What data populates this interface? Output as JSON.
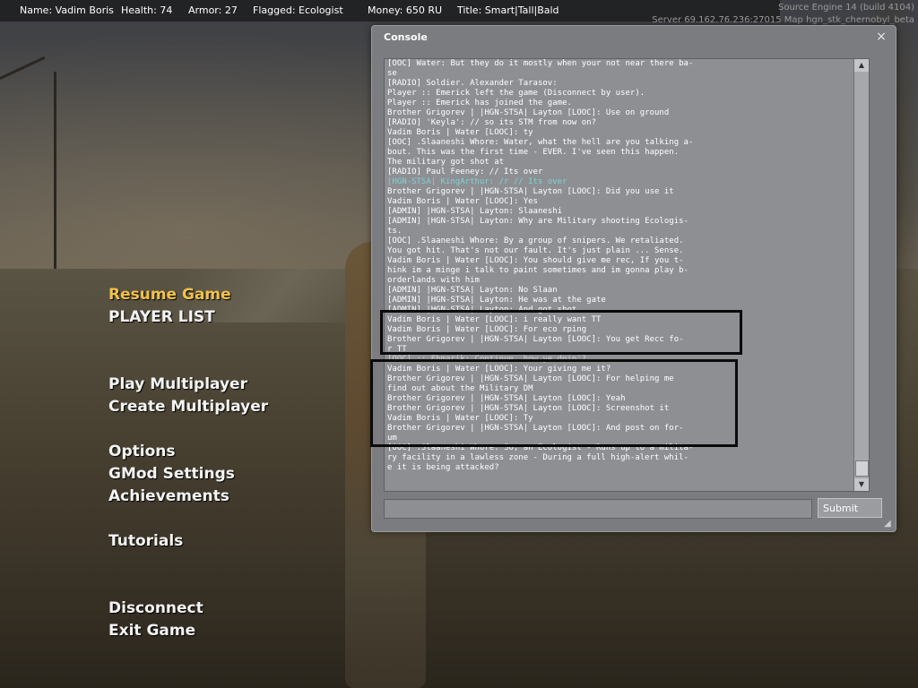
{
  "hud": {
    "name": "Name: Vadim Boris",
    "health": "Health: 74",
    "armor": "Armor: 27",
    "flagged": "Flagged: Ecologist",
    "money": "Money: 650 RU",
    "title": "Title: Smart|Tall|Bald"
  },
  "server": {
    "engine": "Source Engine 14 (build 4104)",
    "info": "Server 69.162.76.236:27015 Map hgn_stk_chernobyl_beta"
  },
  "menu": {
    "resume": "Resume Game",
    "player_list": "PLAYER LIST",
    "play_multi": "Play Multiplayer",
    "create_multi": "Create Multiplayer",
    "options": "Options",
    "gmod_settings": "GMod Settings",
    "achievements": "Achievements",
    "tutorials": "Tutorials",
    "disconnect": "Disconnect",
    "exit": "Exit Game"
  },
  "console": {
    "title": "Console",
    "close": "×",
    "submit": "Submit",
    "input_value": "",
    "lines": [
      "[OOC] Water: But they do it mostly when your not near there ba-",
      "se",
      "[RADIO] Soldier. Alexander Tarasov:",
      "Player :: Emerick left the game (Disconnect by user).",
      "Player :: Emerick has joined the game.",
      "Brother Grigorev | |HGN-STSA| Layton [LOOC]: Use on ground",
      "[RADIO] 'Keyla': // so its STM from now on?",
      "Vadim Boris | Water [LOOC]: ty",
      "[OOC] .Slaaneshi Whore: Water, what the hell are you talking a-",
      "bout. This was the first time - EVER. I've seen this happen.",
      "The military got shot at",
      "[RADIO] Paul Feeney: // Its over",
      "|HGN-STSA| KingArthur: /r // Its over",
      "Brother Grigorev | |HGN-STSA| Layton [LOOC]: Did you use it",
      "Vadim Boris | Water [LOOC]: Yes",
      "[ADMIN] |HGN-STSA| Layton: Slaaneshi",
      "[ADMIN] |HGN-STSA| Layton: Why are Military shooting Ecologis-",
      "ts.",
      "[OOC] .Slaaneshi Whore: By a group of snipers. We retaliated.",
      "You got hit. That's not our fault. It's just plain ... Sense.",
      "Vadim Boris | Water [LOOC]: You should give me rec, If you t-",
      "hink im a minge i talk to paint sometimes and im gonna play b-",
      "orderlands with him",
      "[ADMIN] |HGN-STSA| Layton: No Slaan",
      "[ADMIN] |HGN-STSA| Layton: He was at the gate",
      "[ADMIN] |HGN-STSA| Layton: And got shot",
      "Vadim Boris | Water [LOOC]: i really want TT",
      "Vadim Boris | Water [LOOC]: For eco rping",
      "Brother Grigorev | |HGN-STSA| Layton [LOOC]: You get Recc fo-",
      "r TT",
      "[OOC] :: Ehmarik: Continue, how ye doin'?",
      "Vadim Boris | Water [LOOC]: Your giving me it?",
      "Brother Grigorev | |HGN-STSA| Layton [LOOC]: For helping me",
      "find out about the Military DM",
      "Brother Grigorev | |HGN-STSA| Layton [LOOC]: Yeah",
      "Brother Grigorev | |HGN-STSA| Layton [LOOC]: Screenshot it",
      "Vadim Boris | Water [LOOC]: Ty",
      "Brother Grigorev | |HGN-STSA| Layton [LOOC]: And post on for-",
      "um",
      "[OOC] .Slaaneshi Whore: So, an Ecologist - Runs up to a milita-",
      "ry facility in a lawless zone - During a full high-alert whil-",
      "e it is being attacked?"
    ]
  },
  "colors": {
    "menu_active": "#f2c24a",
    "admin_name_highlight": "#7fd3d3"
  },
  "icons": {
    "close": "close-icon",
    "scroll_up": "arrow-up-icon",
    "scroll_down": "arrow-down-icon",
    "resize": "resize-grip-icon"
  }
}
